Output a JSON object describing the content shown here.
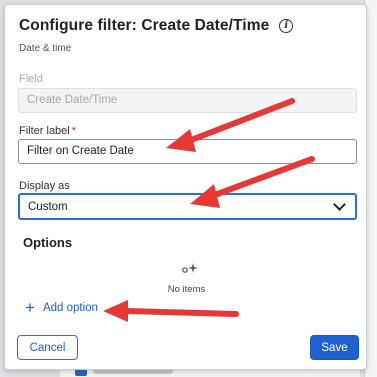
{
  "dialog": {
    "title": "Configure filter: Create Date/Time",
    "subtitle": "Date & time",
    "field": {
      "label": "Field",
      "value": "Create Date/Time"
    },
    "filter_label": {
      "label": "Filter label",
      "required_mark": "*",
      "value": "Filter on Create Date"
    },
    "display_as": {
      "label": "Display as",
      "selected": "Custom"
    },
    "options": {
      "heading": "Options",
      "empty_text": "No items",
      "add_label": "Add option"
    },
    "buttons": {
      "cancel": "Cancel",
      "save": "Save"
    }
  },
  "annotations": {
    "arrow_color": "#e53935"
  },
  "colors": {
    "accent": "#1f62cf",
    "required": "#c62828"
  }
}
